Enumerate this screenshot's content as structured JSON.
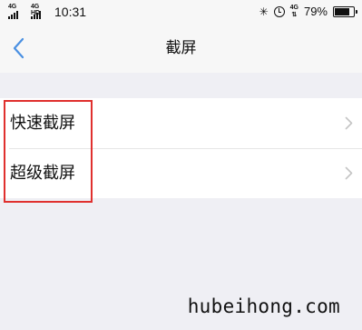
{
  "status_bar": {
    "network_1": "4G",
    "network_2": "4G HD",
    "time": "10:31",
    "network_3": "4G",
    "battery_percent": "79%",
    "battery_level": 0.79
  },
  "nav": {
    "back_icon": "chevron-left-icon",
    "title": "截屏"
  },
  "settings_list": [
    {
      "label": "快速截屏",
      "icon": "chevron-right-icon"
    },
    {
      "label": "超级截屏",
      "icon": "chevron-right-icon"
    }
  ],
  "colors": {
    "accent": "#4a90e2",
    "highlight_border": "#e0302e",
    "background": "#efeff4"
  },
  "watermark": "hubeihong.com"
}
